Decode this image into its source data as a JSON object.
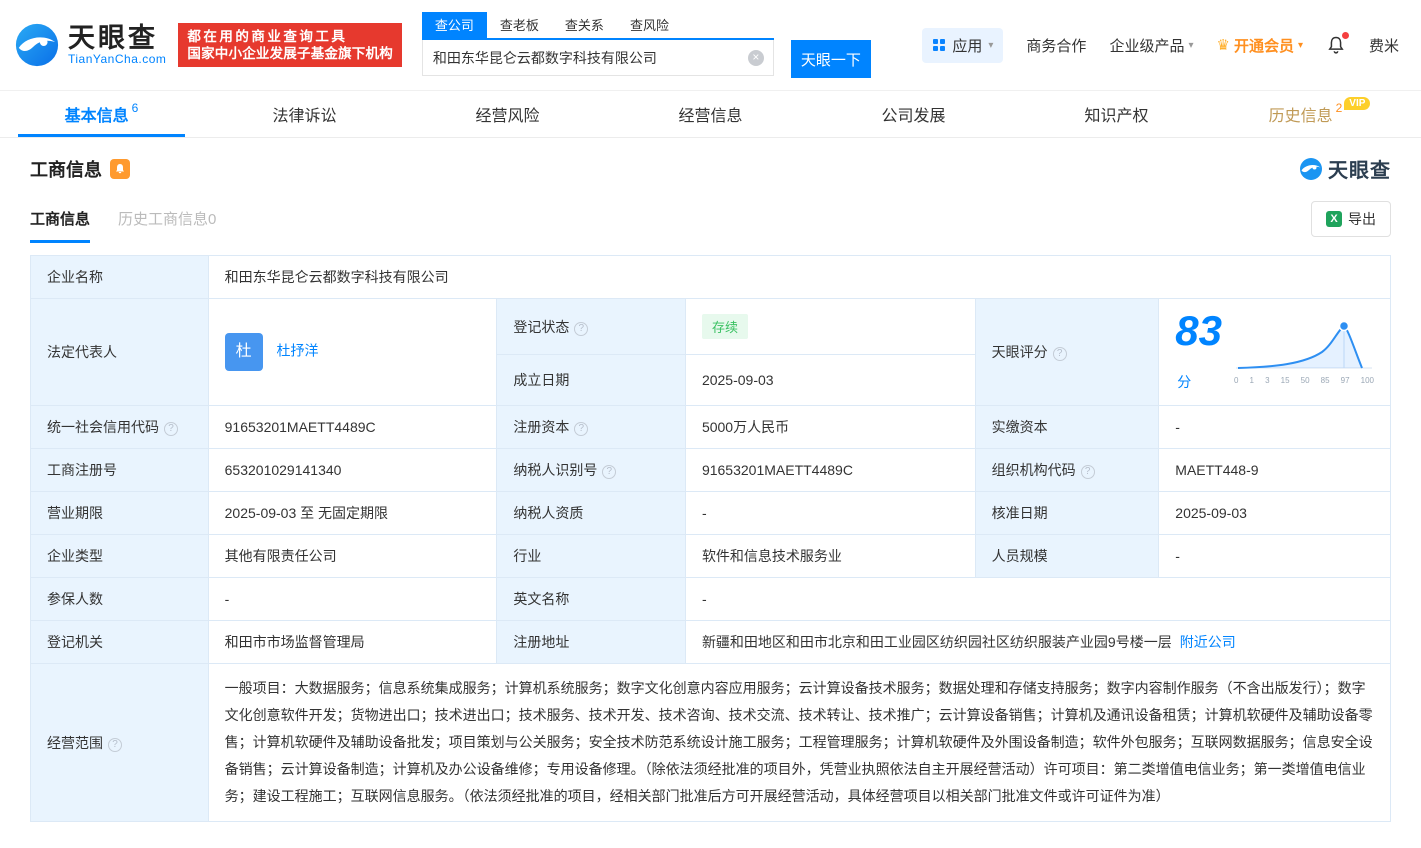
{
  "icons": {
    "help": "?",
    "caret": "▾",
    "close": "×",
    "crown": "♛",
    "export_x": "X"
  },
  "header": {
    "logo": {
      "brand": "天眼查",
      "domain": "TianYanCha.com"
    },
    "banner": {
      "line1": "都在用的商业查询工具",
      "line2": "国家中小企业发展子基金旗下机构"
    },
    "search": {
      "tabs": [
        {
          "label": "查公司"
        },
        {
          "label": "查老板"
        },
        {
          "label": "查关系"
        },
        {
          "label": "查风险"
        }
      ],
      "value": "和田东华昆仑云都数字科技有限公司",
      "button_label": "天眼一下"
    },
    "nav": {
      "app_label": "应用",
      "cooperation": "商务合作",
      "enterprise": "企业级产品",
      "vip": "开通会员",
      "user": "费米"
    }
  },
  "main_tabs": [
    {
      "label": "基本信息",
      "count": "6"
    },
    {
      "label": "法律诉讼",
      "count": ""
    },
    {
      "label": "经营风险",
      "count": ""
    },
    {
      "label": "经营信息",
      "count": ""
    },
    {
      "label": "公司发展",
      "count": ""
    },
    {
      "label": "知识产权",
      "count": ""
    },
    {
      "label": "历史信息",
      "count": "2",
      "vip_tag": "VIP"
    }
  ],
  "section": {
    "title": "工商信息",
    "watermark": "天眼查",
    "subtab_active": "工商信息",
    "subtab_history": "历史工商信息",
    "subtab_history_count": "0",
    "export_label": "导出"
  },
  "fields": {
    "company_name": {
      "label": "企业名称",
      "value": "和田东华昆仑云都数字科技有限公司"
    },
    "legal_rep": {
      "label": "法定代表人",
      "value": "杜抒洋",
      "avatar": "杜"
    },
    "reg_status": {
      "label": "登记状态",
      "value": "存续"
    },
    "score": {
      "label": "天眼评分",
      "value": "83",
      "unit": "分"
    },
    "establish_date": {
      "label": "成立日期",
      "value": "2025-09-03"
    },
    "credit_code": {
      "label": "统一社会信用代码",
      "value": "91653201MAETT4489C"
    },
    "reg_capital": {
      "label": "注册资本",
      "value": "5000万人民币"
    },
    "paid_capital": {
      "label": "实缴资本",
      "value": "-"
    },
    "reg_number": {
      "label": "工商注册号",
      "value": "653201029141340"
    },
    "taxpayer_id": {
      "label": "纳税人识别号",
      "value": "91653201MAETT4489C"
    },
    "org_code": {
      "label": "组织机构代码",
      "value": "MAETT448-9"
    },
    "business_term": {
      "label": "营业期限",
      "value": "2025-09-03 至 无固定期限"
    },
    "taxpayer_qualification": {
      "label": "纳税人资质",
      "value": "-"
    },
    "approval_date": {
      "label": "核准日期",
      "value": "2025-09-03"
    },
    "company_type": {
      "label": "企业类型",
      "value": "其他有限责任公司"
    },
    "industry": {
      "label": "行业",
      "value": "软件和信息技术服务业"
    },
    "staff_size": {
      "label": "人员规模",
      "value": "-"
    },
    "insured_count": {
      "label": "参保人数",
      "value": "-"
    },
    "english_name": {
      "label": "英文名称",
      "value": "-"
    },
    "reg_authority": {
      "label": "登记机关",
      "value": "和田市市场监督管理局"
    },
    "reg_address": {
      "label": "注册地址",
      "value": "新疆和田地区和田市北京和田工业园区纺织园社区纺织服装产业园9号楼一层",
      "link": "附近公司"
    },
    "business_scope": {
      "label": "经营范围",
      "value": "一般项目：大数据服务；信息系统集成服务；计算机系统服务；数字文化创意内容应用服务；云计算设备技术服务；数据处理和存储支持服务；数字内容制作服务（不含出版发行）；数字文化创意软件开发；货物进出口；技术进出口；技术服务、技术开发、技术咨询、技术交流、技术转让、技术推广；云计算设备销售；计算机及通讯设备租赁；计算机软硬件及辅助设备零售；计算机软硬件及辅助设备批发；项目策划与公关服务；安全技术防范系统设计施工服务；工程管理服务；计算机软硬件及外围设备制造；软件外包服务；互联网数据服务；信息安全设备销售；云计算设备制造；计算机及办公设备维修；专用设备修理。（除依法须经批准的项目外，凭营业执照依法自主开展经营活动）许可项目：第二类增值电信业务；第一类增值电信业务；建设工程施工；互联网信息服务。（依法须经批准的项目，经相关部门批准后方可开展经营活动，具体经营项目以相关部门批准文件或许可证件为准）"
    }
  },
  "score_chart": {
    "ticks": [
      "0",
      "1",
      "3",
      "15",
      "50",
      "85",
      "97",
      "100"
    ]
  }
}
